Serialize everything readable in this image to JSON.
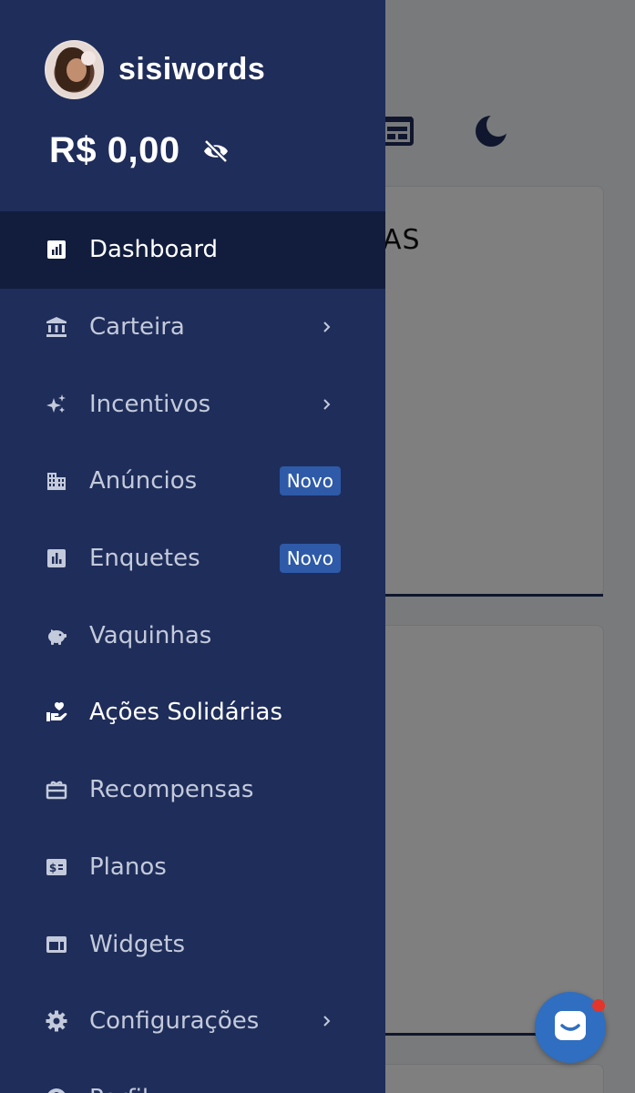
{
  "background": {
    "card_title_fragment": "AS"
  },
  "profile": {
    "username": "sisiwords",
    "balance": "R$ 0,00"
  },
  "menu": {
    "items": [
      {
        "label": "Dashboard",
        "icon": "chart-icon",
        "active": true
      },
      {
        "label": "Carteira",
        "icon": "bank-icon",
        "has_submenu": true
      },
      {
        "label": "Incentivos",
        "icon": "sparkles-icon",
        "has_submenu": true
      },
      {
        "label": "Anúncios",
        "icon": "building-icon",
        "badge": "Novo"
      },
      {
        "label": "Enquetes",
        "icon": "poll-icon",
        "badge": "Novo"
      },
      {
        "label": "Vaquinhas",
        "icon": "piggy-bank-icon"
      },
      {
        "label": "Ações Solidárias",
        "icon": "heart-hand-icon"
      },
      {
        "label": "Recompensas",
        "icon": "gift-icon"
      },
      {
        "label": "Planos",
        "icon": "money-icon"
      },
      {
        "label": "Widgets",
        "icon": "widget-icon"
      },
      {
        "label": "Configurações",
        "icon": "gear-icon",
        "has_submenu": true
      },
      {
        "label": "Perfil",
        "icon": "user-icon"
      }
    ]
  },
  "colors": {
    "drawer_bg": "#1f2d5a",
    "active_bg": "#121d3d",
    "badge_bg": "#2e5aa8",
    "chat_button": "#2f6ec0",
    "notification_dot": "#e2352b"
  }
}
